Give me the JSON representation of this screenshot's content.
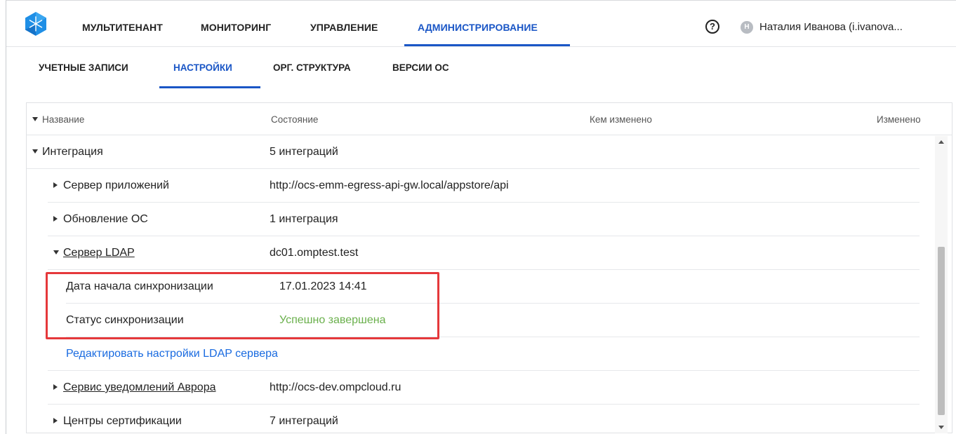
{
  "topnav": {
    "items": [
      "МУЛЬТИТЕНАНТ",
      "МОНИТОРИНГ",
      "УПРАВЛЕНИЕ",
      "АДМИНИСТРИРОВАНИЕ"
    ],
    "active": "АДМИНИСТРИРОВАНИЕ",
    "help_symbol": "?",
    "user_initial": "Н",
    "user_name": "Наталия Иванова (i.ivanova..."
  },
  "subtabs": {
    "items": [
      "УЧЕТНЫЕ ЗАПИСИ",
      "НАСТРОЙКИ",
      "ОРГ. СТРУКТУРА",
      "ВЕРСИИ ОС"
    ],
    "active": "НАСТРОЙКИ"
  },
  "table": {
    "columns": [
      "Название",
      "Состояние",
      "Кем изменено",
      "Изменено"
    ],
    "rows": [
      {
        "name": "Интеграция",
        "value": "5 интеграций"
      },
      {
        "name": "Сервер приложений",
        "value": "http://ocs-emm-egress-api-gw.local/appstore/api"
      },
      {
        "name": "Обновление ОС",
        "value": "1 интеграция"
      },
      {
        "name": "Сервер LDAP",
        "value": "dc01.omptest.test"
      },
      {
        "name": "Дата начала синхронизации",
        "value": "17.01.2023 14:41"
      },
      {
        "name": "Статус синхронизации",
        "value": "Успешно завершена"
      },
      {
        "name": "Редактировать настройки LDAP сервера",
        "value": ""
      },
      {
        "name": "Сервис уведомлений Аврора",
        "value": "http://ocs-dev.ompcloud.ru"
      },
      {
        "name": "Центры сертификации",
        "value": "7 интеграций"
      }
    ]
  },
  "colors": {
    "accent": "#1a56c6",
    "link": "#1a6be0",
    "success": "#6ab04c",
    "highlight": "#e5383b"
  },
  "icons": {
    "logo": "snowflake-logo-icon",
    "help": "question-circle-icon",
    "expand": "caret-down-icon",
    "collapse": "caret-right-icon"
  }
}
